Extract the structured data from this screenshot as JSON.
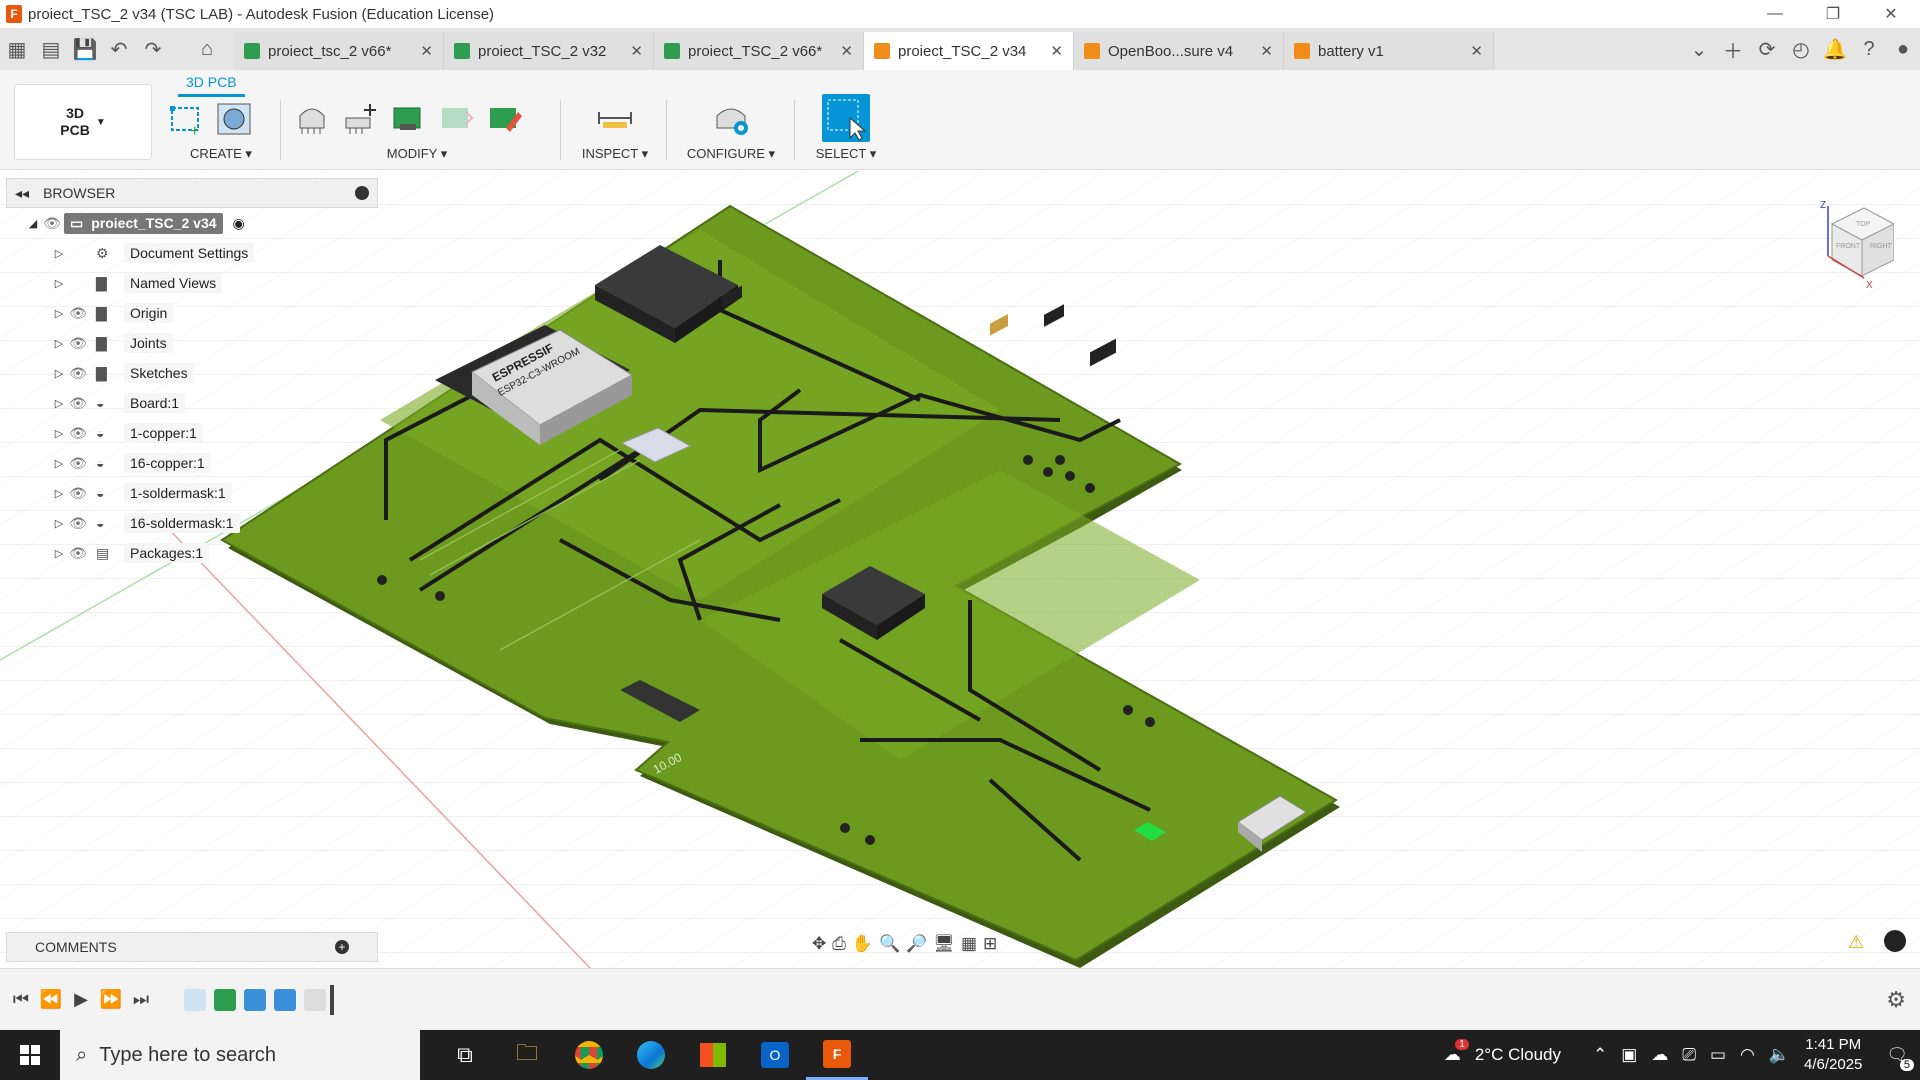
{
  "window": {
    "title": "proiect_TSC_2 v34 (TSC LAB) - Autodesk Fusion (Education License)"
  },
  "tabs": [
    {
      "label": "proiect_tsc_2 v66*",
      "color": "#2e9d4f"
    },
    {
      "label": "proiect_TSC_2 v32",
      "color": "#2e9d4f"
    },
    {
      "label": "proiect_TSC_2 v66*",
      "color": "#2e9d4f"
    },
    {
      "label": "proiect_TSC_2 v34",
      "color": "#f08c1a"
    },
    {
      "label": "OpenBoo...sure v4",
      "color": "#f08c1a"
    },
    {
      "label": "battery v1",
      "color": "#f08c1a"
    }
  ],
  "ribbon": {
    "workspace": "3D\nPCB",
    "active_tab": "3D PCB",
    "groups": {
      "create": "CREATE ▾",
      "modify": "MODIFY ▾",
      "inspect": "INSPECT ▾",
      "configure": "CONFIGURE ▾",
      "select": "SELECT ▾"
    }
  },
  "browser": {
    "title": "BROWSER",
    "root": "proiect_TSC_2 v34",
    "items": [
      {
        "label": "Document Settings",
        "icon": "gear-icon"
      },
      {
        "label": "Named Views",
        "icon": "folder-icon"
      },
      {
        "label": "Origin",
        "icon": "folder-icon"
      },
      {
        "label": "Joints",
        "icon": "folder-icon"
      },
      {
        "label": "Sketches",
        "icon": "folder-icon"
      },
      {
        "label": "Board:1",
        "icon": "component-icon"
      },
      {
        "label": "1-copper:1",
        "icon": "component-icon"
      },
      {
        "label": "16-copper:1",
        "icon": "component-icon"
      },
      {
        "label": "1-soldermask:1",
        "icon": "component-icon"
      },
      {
        "label": "16-soldermask:1",
        "icon": "component-icon"
      },
      {
        "label": "Packages:1",
        "icon": "packages-icon"
      }
    ]
  },
  "comments": {
    "title": "COMMENTS"
  },
  "viewcube": {
    "top": "TOP",
    "front": "FRONT",
    "right": "RIGHT",
    "z": "Z",
    "x": "X"
  },
  "taskbar": {
    "search_placeholder": "Type here to search",
    "weather": "2°C  Cloudy",
    "time": "1:41 PM",
    "date": "4/6/2025",
    "notifications": "5",
    "weather_badge": "1"
  },
  "pcb": {
    "module_brand": "ESPRESSIF",
    "module_model": "ESP32-C3-WROOM",
    "board_label": "10.00"
  }
}
